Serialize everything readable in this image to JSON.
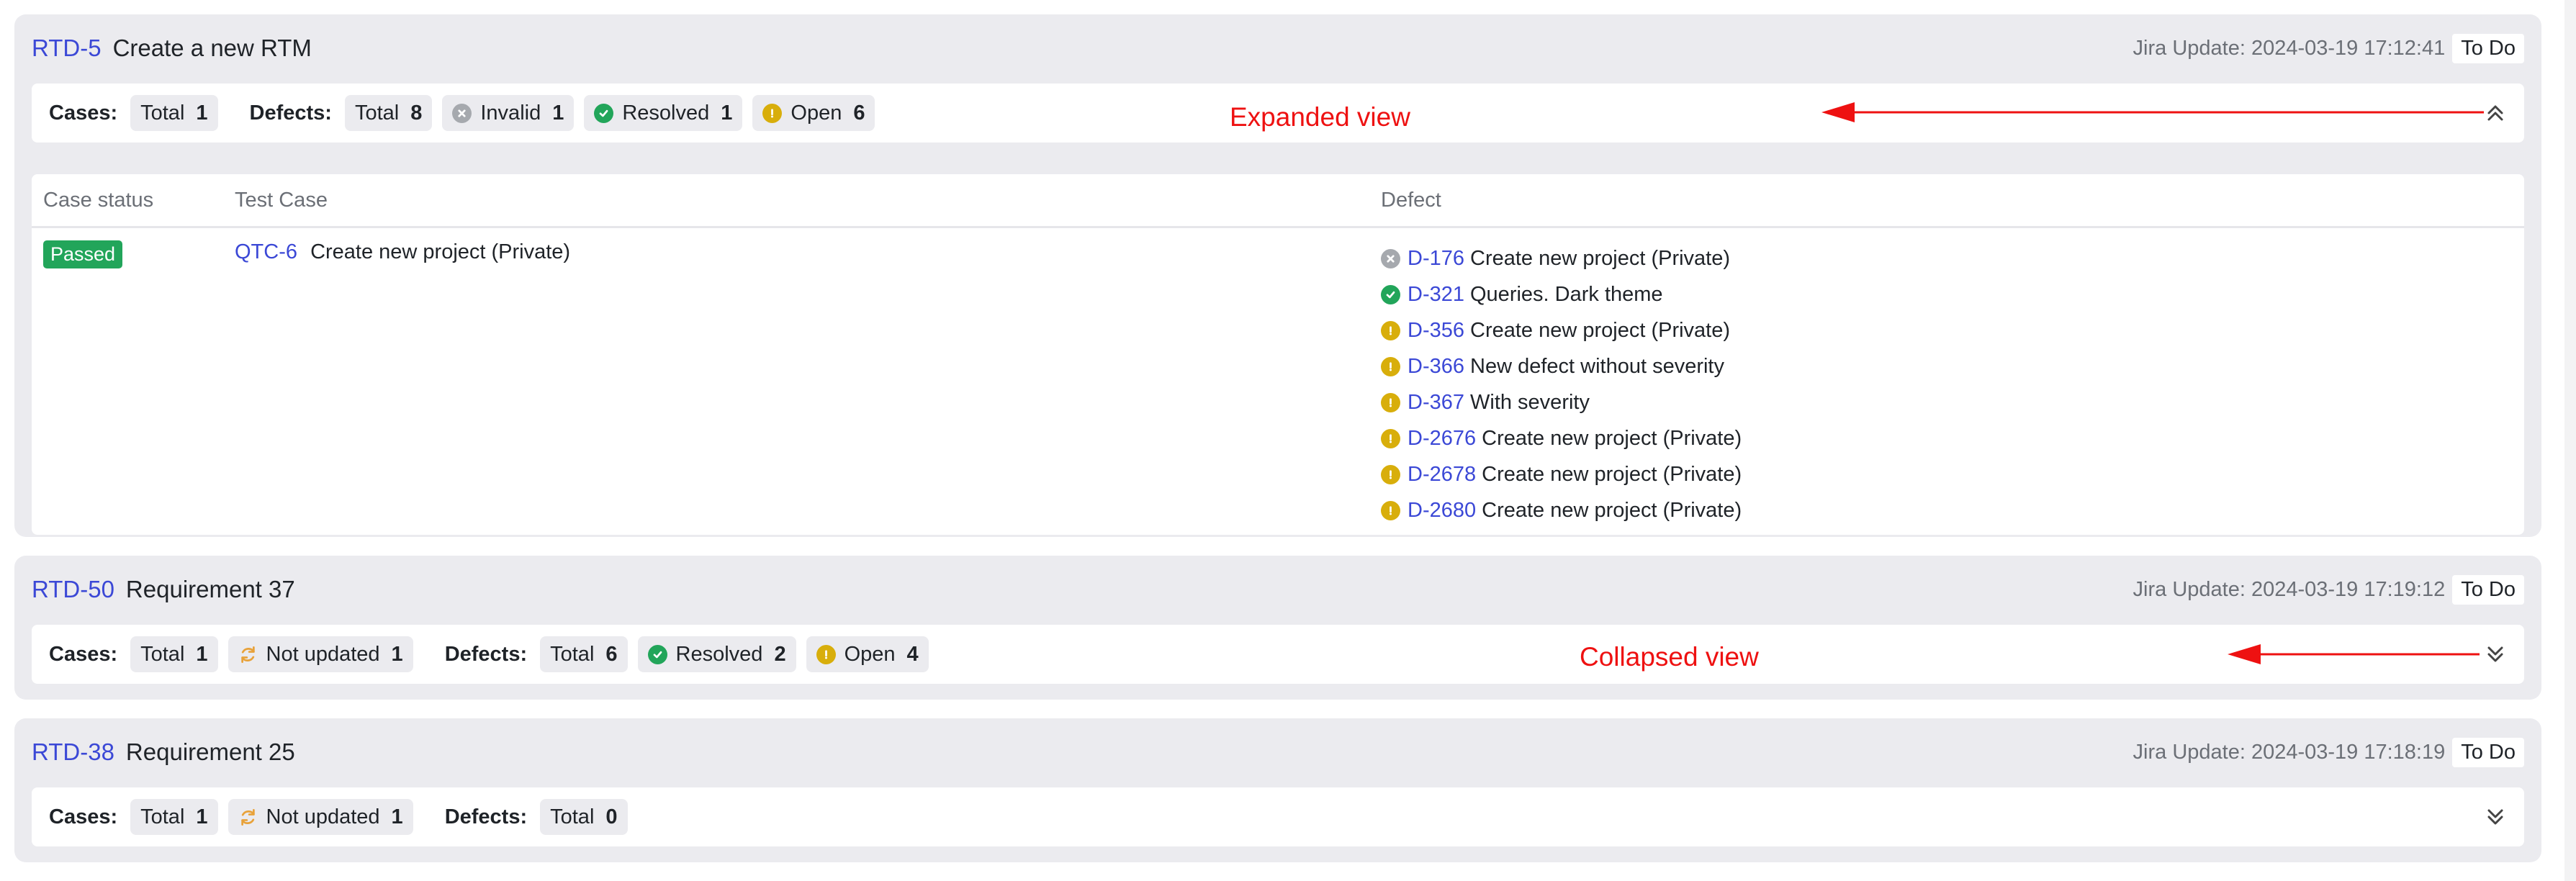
{
  "requirements": [
    {
      "key": "RTD-5",
      "title": "Create a new RTM",
      "jira_update": "Jira Update: 2024-03-19 17:12:41",
      "status": "To Do",
      "cases": {
        "label": "Cases:",
        "total_label": "Total",
        "total": "1"
      },
      "defects": {
        "label": "Defects:",
        "total_label": "Total",
        "total": "8",
        "invalid_label": "Invalid",
        "invalid": "1",
        "resolved_label": "Resolved",
        "resolved": "1",
        "open_label": "Open",
        "open": "6"
      },
      "expanded": true,
      "table": {
        "headers": [
          "Case status",
          "Test Case",
          "Defect"
        ],
        "case_status": "Passed",
        "test_case_key": "QTC-6",
        "test_case_title": "Create new project (Private)",
        "defects": [
          {
            "state": "invalid",
            "key": "D-176",
            "title": "Create new project (Private)"
          },
          {
            "state": "resolved",
            "key": "D-321",
            "title": "Queries. Dark theme"
          },
          {
            "state": "open",
            "key": "D-356",
            "title": "Create new project (Private)"
          },
          {
            "state": "open",
            "key": "D-366",
            "title": "New defect without severity"
          },
          {
            "state": "open",
            "key": "D-367",
            "title": "With severity"
          },
          {
            "state": "open",
            "key": "D-2676",
            "title": "Create new project (Private)"
          },
          {
            "state": "open",
            "key": "D-2678",
            "title": "Create new project (Private)"
          },
          {
            "state": "open",
            "key": "D-2680",
            "title": "Create new project (Private)"
          }
        ]
      }
    },
    {
      "key": "RTD-50",
      "title": "Requirement 37",
      "jira_update": "Jira Update: 2024-03-19 17:19:12",
      "status": "To Do",
      "cases": {
        "label": "Cases:",
        "total_label": "Total",
        "total": "1",
        "not_updated_label": "Not updated",
        "not_updated": "1"
      },
      "defects": {
        "label": "Defects:",
        "total_label": "Total",
        "total": "6",
        "resolved_label": "Resolved",
        "resolved": "2",
        "open_label": "Open",
        "open": "4"
      },
      "expanded": false
    },
    {
      "key": "RTD-38",
      "title": "Requirement 25",
      "jira_update": "Jira Update: 2024-03-19 17:18:19",
      "status": "To Do",
      "cases": {
        "label": "Cases:",
        "total_label": "Total",
        "total": "1",
        "not_updated_label": "Not updated",
        "not_updated": "1"
      },
      "defects": {
        "label": "Defects:",
        "total_label": "Total",
        "total": "0"
      },
      "expanded": false
    }
  ],
  "annotations": {
    "expanded": "Expanded view",
    "collapsed": "Collapsed view"
  },
  "colors": {
    "link": "#3b48d6",
    "passed": "#22a55a",
    "open_icon": "#d8ae0b",
    "invalid_icon": "#a6a9ae",
    "not_updated_icon": "#e8a23a",
    "annotation": "#ee1111"
  },
  "icons": {
    "invalid": "x-circle-icon",
    "resolved": "check-circle-icon",
    "open": "exclamation-circle-icon",
    "not_updated": "refresh-icon",
    "collapse": "chevron-double-up-icon",
    "expand": "chevron-double-down-icon"
  }
}
